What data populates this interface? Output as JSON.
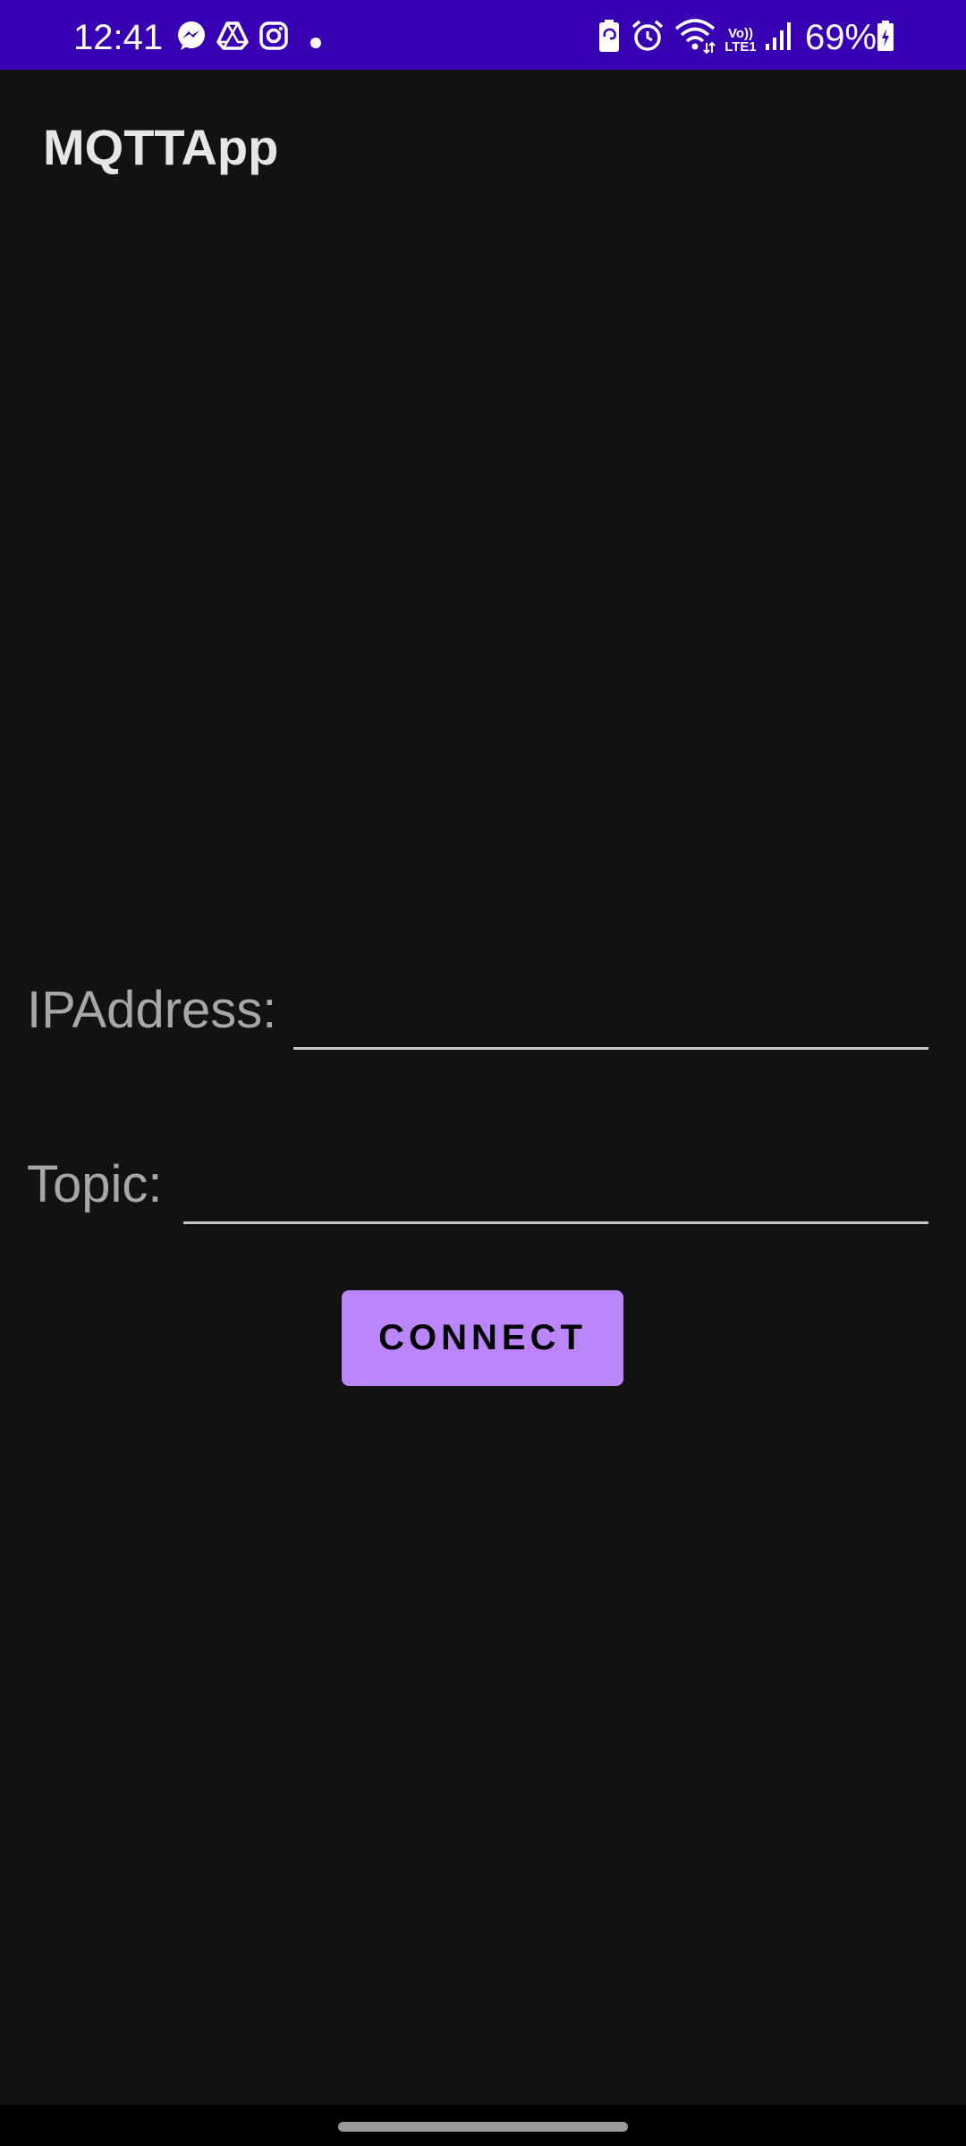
{
  "status_bar": {
    "time": "12:41",
    "battery": "69%",
    "lte_top": "Vo))",
    "lte_bottom": "LTE1",
    "left_icons": [
      "messenger-icon",
      "drive-icon",
      "instagram-icon"
    ],
    "right_icons": [
      "battery-saver-icon",
      "alarm-icon",
      "wifi-icon",
      "signal-icon",
      "battery-icon"
    ],
    "color": "#3700b3"
  },
  "app_bar": {
    "title": "MQTTApp"
  },
  "form": {
    "ip_label": "IPAddress:",
    "ip_value": "",
    "topic_label": "Topic:",
    "topic_value": "",
    "connect_label": "CONNECT"
  },
  "colors": {
    "background": "#121212",
    "accent": "#bb86fc",
    "status_bar": "#3700b3"
  }
}
